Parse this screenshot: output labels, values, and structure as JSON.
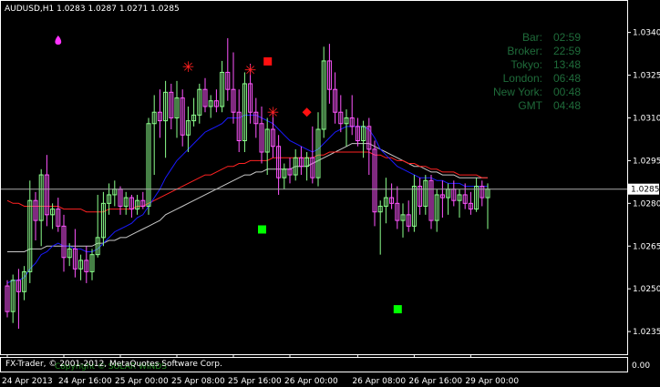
{
  "window": {
    "symbol_header": "AUDUSD,H1  1.0283 1.0287 1.0271 1.0285",
    "copyright": "FX-Trader, © 2001-2012, MetaQuotes Software Corp.",
    "footer_overlay": "Copyright © SOLAR WINDS",
    "subwindow_value": "0.00"
  },
  "colors": {
    "background": "#000000",
    "frame": "#ffffff",
    "bull_candle": "#8cff8c",
    "bear_candle": "#ff55ff",
    "ma_fast": "#1a1aff",
    "ma_mid": "#ff2222",
    "ma_slow": "#c8c8c8",
    "clock_text": "#1f6b3a",
    "price_line": "#aaaaaa"
  },
  "clock_panel": {
    "rows": [
      {
        "label": "Bar:",
        "value": "02:59"
      },
      {
        "label": "Broker:",
        "value": "22:59"
      },
      {
        "label": "Tokyo:",
        "value": "13:48"
      },
      {
        "label": "London:",
        "value": "06:48"
      },
      {
        "label": "New York:",
        "value": "00:48"
      },
      {
        "label": "GMT",
        "value": "04:48"
      }
    ]
  },
  "chart_data": {
    "type": "candlestick",
    "symbol": "AUDUSD",
    "timeframe": "H1",
    "ylim": [
      1.0228,
      1.0345
    ],
    "y_ticks": [
      "1.0340",
      "1.0325",
      "1.0310",
      "1.0295",
      "1.0280",
      "1.0265",
      "1.0250",
      "1.0235"
    ],
    "y_tick_values": [
      1.034,
      1.0325,
      1.031,
      1.0295,
      1.028,
      1.0265,
      1.025,
      1.0235
    ],
    "current_price": "1.0285",
    "current_price_value": 1.0285,
    "x_ticks": [
      "24 Apr 2013",
      "24 Apr 16:00",
      "25 Apr 00:00",
      "25 Apr 08:00",
      "25 Apr 16:00",
      "26 Apr 00:00",
      "26 Apr 08:00",
      "26 Apr 16:00",
      "29 Apr 00:00"
    ],
    "x_tick_bar_index": [
      0,
      10,
      20,
      30,
      40,
      50,
      62,
      72,
      82
    ],
    "candles": [
      [
        1.0251,
        1.0253,
        1.024,
        1.0242
      ],
      [
        1.0242,
        1.0255,
        1.0238,
        1.0253
      ],
      [
        1.0253,
        1.0257,
        1.0236,
        1.0249
      ],
      [
        1.0249,
        1.0258,
        1.0246,
        1.0256
      ],
      [
        1.0256,
        1.0288,
        1.0252,
        1.0281
      ],
      [
        1.0281,
        1.0284,
        1.0267,
        1.0274
      ],
      [
        1.0274,
        1.0292,
        1.0265,
        1.029
      ],
      [
        1.029,
        1.0297,
        1.0272,
        1.0276
      ],
      [
        1.0276,
        1.028,
        1.0271,
        1.0278
      ],
      [
        1.0278,
        1.0282,
        1.027,
        1.0272
      ],
      [
        1.0272,
        1.0276,
        1.0256,
        1.0261
      ],
      [
        1.0261,
        1.0266,
        1.0258,
        1.0264
      ],
      [
        1.0264,
        1.0271,
        1.0254,
        1.0257
      ],
      [
        1.0257,
        1.0262,
        1.0253,
        1.026
      ],
      [
        1.026,
        1.0265,
        1.0252,
        1.0256
      ],
      [
        1.0256,
        1.0264,
        1.0253,
        1.0262
      ],
      [
        1.0262,
        1.0283,
        1.0261,
        1.0268
      ],
      [
        1.0268,
        1.0284,
        1.0265,
        1.028
      ],
      [
        1.028,
        1.0287,
        1.0276,
        1.0283
      ],
      [
        1.0283,
        1.0288,
        1.0279,
        1.0285
      ],
      [
        1.0285,
        1.0286,
        1.0276,
        1.0279
      ],
      [
        1.0279,
        1.0284,
        1.0276,
        1.0282
      ],
      [
        1.0282,
        1.0283,
        1.0275,
        1.0278
      ],
      [
        1.0278,
        1.0283,
        1.0276,
        1.0281
      ],
      [
        1.0281,
        1.0284,
        1.0278,
        1.0279
      ],
      [
        1.0279,
        1.031,
        1.0276,
        1.0308
      ],
      [
        1.0308,
        1.0318,
        1.029,
        1.0312
      ],
      [
        1.0312,
        1.032,
        1.0303,
        1.0309
      ],
      [
        1.0309,
        1.0323,
        1.0296,
        1.0319
      ],
      [
        1.0319,
        1.0322,
        1.0306,
        1.031
      ],
      [
        1.031,
        1.0323,
        1.0303,
        1.0317
      ],
      [
        1.0317,
        1.032,
        1.03,
        1.0304
      ],
      [
        1.0304,
        1.0314,
        1.0298,
        1.0309
      ],
      [
        1.0309,
        1.0317,
        1.0307,
        1.0311
      ],
      [
        1.0311,
        1.0322,
        1.0308,
        1.032
      ],
      [
        1.032,
        1.0324,
        1.0312,
        1.0314
      ],
      [
        1.0314,
        1.0318,
        1.031,
        1.0316
      ],
      [
        1.0316,
        1.032,
        1.0312,
        1.0314
      ],
      [
        1.0314,
        1.033,
        1.0312,
        1.0326
      ],
      [
        1.0326,
        1.0338,
        1.0316,
        1.032
      ],
      [
        1.032,
        1.0333,
        1.0308,
        1.0312
      ],
      [
        1.0312,
        1.032,
        1.0298,
        1.0302
      ],
      [
        1.0302,
        1.0326,
        1.0298,
        1.0322
      ],
      [
        1.0322,
        1.0329,
        1.0308,
        1.0312
      ],
      [
        1.0312,
        1.0317,
        1.0303,
        1.0308
      ],
      [
        1.0308,
        1.0314,
        1.0294,
        1.0298
      ],
      [
        1.0298,
        1.031,
        1.029,
        1.0306
      ],
      [
        1.0306,
        1.0312,
        1.0296,
        1.03
      ],
      [
        1.03,
        1.0304,
        1.0283,
        1.0289
      ],
      [
        1.0289,
        1.0294,
        1.0285,
        1.0292
      ],
      [
        1.0292,
        1.0296,
        1.0287,
        1.029
      ],
      [
        1.029,
        1.0299,
        1.0288,
        1.0296
      ],
      [
        1.0296,
        1.03,
        1.029,
        1.0293
      ],
      [
        1.0293,
        1.0298,
        1.0288,
        1.0296
      ],
      [
        1.0296,
        1.0307,
        1.0287,
        1.0289
      ],
      [
        1.0289,
        1.0312,
        1.0286,
        1.0306
      ],
      [
        1.0306,
        1.0335,
        1.0303,
        1.033
      ],
      [
        1.033,
        1.0336,
        1.0315,
        1.032
      ],
      [
        1.032,
        1.0326,
        1.0308,
        1.0312
      ],
      [
        1.0312,
        1.0318,
        1.0305,
        1.0308
      ],
      [
        1.0308,
        1.0313,
        1.03,
        1.031
      ],
      [
        1.031,
        1.0318,
        1.0304,
        1.0307
      ],
      [
        1.0307,
        1.031,
        1.03,
        1.0302
      ],
      [
        1.0302,
        1.0309,
        1.0296,
        1.0307
      ],
      [
        1.0307,
        1.031,
        1.029,
        1.0299
      ],
      [
        1.0299,
        1.0302,
        1.0272,
        1.0277
      ],
      [
        1.0277,
        1.0281,
        1.0262,
        1.0279
      ],
      [
        1.0279,
        1.0289,
        1.0273,
        1.0282
      ],
      [
        1.0282,
        1.0287,
        1.0278,
        1.028
      ],
      [
        1.028,
        1.0286,
        1.0271,
        1.0274
      ],
      [
        1.0274,
        1.028,
        1.0268,
        1.0276
      ],
      [
        1.0276,
        1.0281,
        1.027,
        1.0272
      ],
      [
        1.0272,
        1.029,
        1.027,
        1.0286
      ],
      [
        1.0286,
        1.0289,
        1.0276,
        1.0279
      ],
      [
        1.0279,
        1.029,
        1.0276,
        1.0288
      ],
      [
        1.0288,
        1.029,
        1.0271,
        1.0274
      ],
      [
        1.0274,
        1.0285,
        1.027,
        1.0283
      ],
      [
        1.0283,
        1.0288,
        1.0275,
        1.0282
      ],
      [
        1.0282,
        1.0287,
        1.0276,
        1.0285
      ],
      [
        1.0285,
        1.0288,
        1.0279,
        1.0281
      ],
      [
        1.0281,
        1.0285,
        1.0275,
        1.0283
      ],
      [
        1.0283,
        1.0287,
        1.0278,
        1.028
      ],
      [
        1.028,
        1.0284,
        1.0276,
        1.0278
      ],
      [
        1.0278,
        1.0289,
        1.0277,
        1.0286
      ],
      [
        1.0286,
        1.0288,
        1.0279,
        1.0282
      ],
      [
        1.0282,
        1.0287,
        1.0271,
        1.0285
      ]
    ],
    "ma_fast": [
      1.0252,
      1.0253,
      1.0253,
      1.0254,
      1.0257,
      1.0259,
      1.0262,
      1.0263,
      1.0265,
      1.0266,
      1.0265,
      1.0265,
      1.0264,
      1.0264,
      1.0263,
      1.0263,
      1.0264,
      1.0266,
      1.0268,
      1.027,
      1.0271,
      1.0272,
      1.0273,
      1.0275,
      1.0276,
      1.0279,
      1.0282,
      1.0285,
      1.0289,
      1.0292,
      1.0295,
      1.0297,
      1.0299,
      1.0301,
      1.0303,
      1.0305,
      1.0306,
      1.0307,
      1.0308,
      1.031,
      1.031,
      1.031,
      1.0311,
      1.0311,
      1.0311,
      1.031,
      1.0309,
      1.0308,
      1.0306,
      1.0304,
      1.0302,
      1.0301,
      1.03,
      1.0299,
      1.0298,
      1.0299,
      1.0301,
      1.0303,
      1.0305,
      1.0306,
      1.0307,
      1.0307,
      1.0307,
      1.0307,
      1.0306,
      1.0303,
      1.0299,
      1.0297,
      1.0295,
      1.0293,
      1.0292,
      1.0291,
      1.029,
      1.0289,
      1.0289,
      1.0289,
      1.0288,
      1.0288,
      1.0287,
      1.0287,
      1.0287,
      1.0286,
      1.0286,
      1.0286,
      1.0286,
      1.0286
    ],
    "ma_mid": [
      1.0281,
      1.028,
      1.028,
      1.0279,
      1.0279,
      1.0279,
      1.0279,
      1.0279,
      1.0279,
      1.0279,
      1.0278,
      1.0278,
      1.0278,
      1.0278,
      1.0277,
      1.0277,
      1.0277,
      1.0277,
      1.0278,
      1.0278,
      1.0278,
      1.0278,
      1.0278,
      1.0279,
      1.0279,
      1.028,
      1.0281,
      1.0282,
      1.0283,
      1.0284,
      1.0285,
      1.0286,
      1.0287,
      1.0288,
      1.0289,
      1.029,
      1.029,
      1.0291,
      1.0292,
      1.0293,
      1.0293,
      1.0294,
      1.0294,
      1.0295,
      1.0295,
      1.0295,
      1.0295,
      1.0296,
      1.0296,
      1.0296,
      1.0296,
      1.0296,
      1.0296,
      1.0296,
      1.0296,
      1.0297,
      1.0297,
      1.0298,
      1.0298,
      1.0298,
      1.0298,
      1.0298,
      1.0298,
      1.0298,
      1.0298,
      1.0297,
      1.0297,
      1.0296,
      1.0296,
      1.0295,
      1.0295,
      1.0294,
      1.0294,
      1.0293,
      1.0293,
      1.0292,
      1.0292,
      1.0291,
      1.0291,
      1.0291,
      1.029,
      1.029,
      1.029,
      1.029,
      1.0289,
      1.0289
    ],
    "ma_slow": [
      1.0263,
      1.0263,
      1.0263,
      1.0263,
      1.0264,
      1.0264,
      1.0264,
      1.0265,
      1.0265,
      1.0265,
      1.0265,
      1.0265,
      1.0265,
      1.0265,
      1.0265,
      1.0265,
      1.0266,
      1.0266,
      1.0267,
      1.0267,
      1.0268,
      1.0268,
      1.0269,
      1.027,
      1.0271,
      1.0272,
      1.0273,
      1.0274,
      1.0276,
      1.0277,
      1.0278,
      1.0279,
      1.028,
      1.0281,
      1.0282,
      1.0283,
      1.0284,
      1.0285,
      1.0286,
      1.0287,
      1.0288,
      1.0289,
      1.029,
      1.029,
      1.0291,
      1.0291,
      1.0292,
      1.0292,
      1.0292,
      1.0292,
      1.0292,
      1.0293,
      1.0293,
      1.0293,
      1.0294,
      1.0295,
      1.0296,
      1.0297,
      1.0298,
      1.0299,
      1.03,
      1.0301,
      1.0301,
      1.0301,
      1.0301,
      1.03,
      1.0299,
      1.0298,
      1.0297,
      1.0296,
      1.0295,
      1.0294,
      1.0293,
      1.0293,
      1.0292,
      1.0291,
      1.0291,
      1.029,
      1.029,
      1.029,
      1.0289,
      1.0289,
      1.0289,
      1.0289,
      1.0289,
      1.0289
    ],
    "markers": [
      {
        "shape": "drop",
        "color": "#ff33ff",
        "bar": 9,
        "price": 1.0337
      },
      {
        "shape": "star",
        "color": "#ff2020",
        "bar": 32,
        "price": 1.0328
      },
      {
        "shape": "star",
        "color": "#ff2020",
        "bar": 43,
        "price": 1.0327
      },
      {
        "shape": "square",
        "color": "#ff1010",
        "bar": 46,
        "price": 1.033
      },
      {
        "shape": "star",
        "color": "#ff2020",
        "bar": 47,
        "price": 1.0312
      },
      {
        "shape": "diamond",
        "color": "#ff1010",
        "bar": 53,
        "price": 1.0312
      },
      {
        "shape": "square",
        "color": "#00ff00",
        "bar": 45,
        "price": 1.0271
      },
      {
        "shape": "square",
        "color": "#00ff00",
        "bar": 69,
        "price": 1.0243
      }
    ]
  }
}
